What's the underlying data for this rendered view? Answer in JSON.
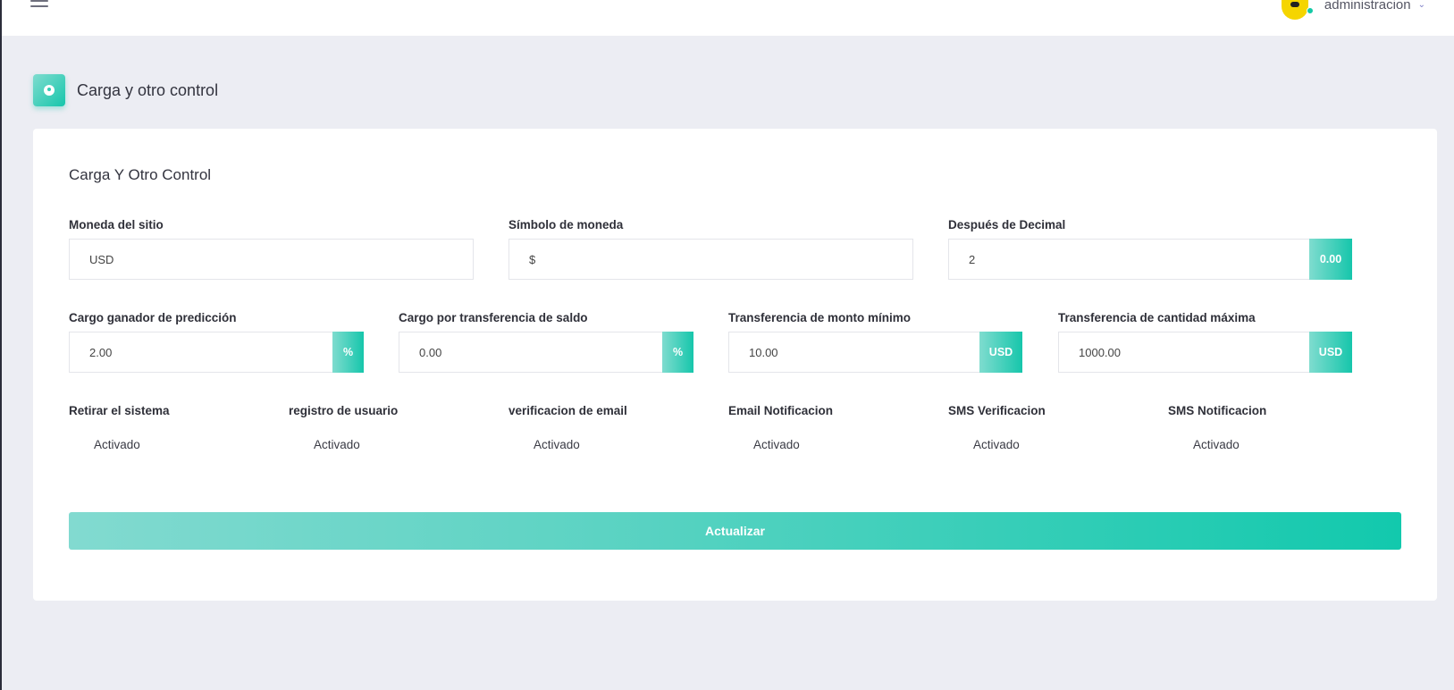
{
  "topbar": {
    "username": "administracion"
  },
  "page": {
    "title": "Carga y otro control"
  },
  "card": {
    "title": "Carga Y Otro Control"
  },
  "fields": {
    "site_currency": {
      "label": "Moneda del sitio",
      "value": "USD"
    },
    "currency_symbol": {
      "label": "Símbolo de moneda",
      "value": "$"
    },
    "after_decimal": {
      "label": "Después de Decimal",
      "value": "2",
      "addon": "0.00"
    },
    "prediction_fee": {
      "label": "Cargo ganador de predicción",
      "value": "2.00",
      "addon": "%"
    },
    "transfer_fee": {
      "label": "Cargo por transferencia de saldo",
      "value": "0.00",
      "addon": "%"
    },
    "min_transfer": {
      "label": "Transferencia de monto mínimo",
      "value": "10.00",
      "addon": "USD"
    },
    "max_transfer": {
      "label": "Transferencia de cantidad máxima",
      "value": "1000.00",
      "addon": "USD"
    }
  },
  "toggles": [
    {
      "label": "Retirar el sistema",
      "status": "Activado"
    },
    {
      "label": "registro de usuario",
      "status": "Activado"
    },
    {
      "label": "verificacion de email",
      "status": "Activado"
    },
    {
      "label": "Email Notificacion",
      "status": "Activado"
    },
    {
      "label": "SMS Verificacion",
      "status": "Activado"
    },
    {
      "label": "SMS Notificacion",
      "status": "Activado"
    }
  ],
  "actions": {
    "update_label": "Actualizar"
  },
  "colors": {
    "accent": "#16c6ab",
    "accent_light": "#7fdccf",
    "background": "#ecedf3"
  },
  "icons": {
    "menu": "hamburger-menu-icon",
    "header": "user-circle-icon",
    "dropdown": "chevron-down-icon"
  }
}
